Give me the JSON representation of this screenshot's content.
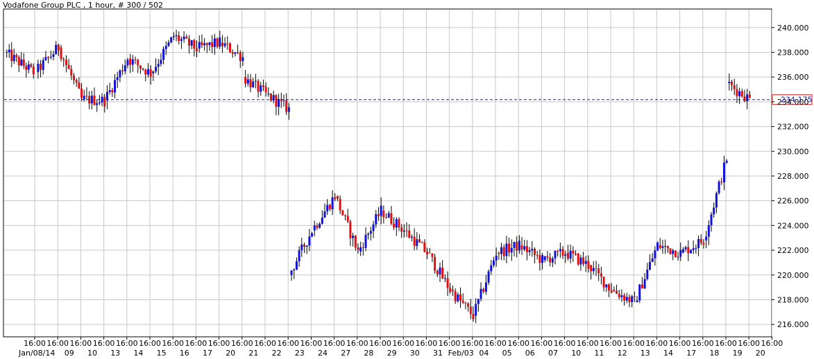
{
  "chart_data": {
    "type": "candlestick",
    "title": "Vodafone Group PLC , 1 hour, # 300 / 502",
    "ylim": [
      215.0,
      241.5
    ],
    "y_ticks": [
      "216.000",
      "218.000",
      "220.000",
      "222.000",
      "224.000",
      "226.000",
      "228.000",
      "230.000",
      "232.000",
      "234.000",
      "236.000",
      "238.000",
      "240.000"
    ],
    "y_tick_values": [
      216,
      218,
      220,
      222,
      224,
      226,
      228,
      230,
      232,
      234,
      236,
      238,
      240
    ],
    "current_price": 234.175,
    "current_price_label": "234.175",
    "grid": true,
    "time_labels": [
      "16:00",
      "16:00",
      "16:00",
      "16:00",
      "16:00",
      "16:00",
      "16:00",
      "16:00",
      "16:00",
      "16:00",
      "16:00",
      "16:00",
      "16:00",
      "16:00",
      "16:00",
      "16:00",
      "16:00",
      "16:00",
      "16:00",
      "16:00",
      "16:00",
      "16:00",
      "16:00",
      "16:00",
      "16:00",
      "16:00",
      "16:00",
      "16:00",
      "16:00",
      "16:00",
      "16:00",
      "16:00",
      "16:00"
    ],
    "date_labels": [
      "Jan/08/14",
      "09",
      "10",
      "13",
      "14",
      "15",
      "16",
      "17",
      "20",
      "21",
      "22",
      "23",
      "24",
      "27",
      "28",
      "29",
      "30",
      "31",
      "Feb/03",
      "04",
      "05",
      "06",
      "07",
      "10",
      "11",
      "12",
      "13",
      "14",
      "17",
      "18",
      "19",
      "20"
    ],
    "colors": {
      "up": "#1010d8",
      "down": "#e01010",
      "grid": "#c8c8c8",
      "price_line": "#1a1aa8"
    },
    "bar_width_note": "",
    "days": [
      {
        "label": "Jan/08/14",
        "start": 238.0,
        "end": 236.4
      },
      {
        "label": "09",
        "start": 236.4,
        "end": 238.4
      },
      {
        "label": "10",
        "start": 238.4,
        "end": 234.2
      },
      {
        "label": "13",
        "start": 234.2,
        "end": 234.1
      },
      {
        "label": "14",
        "start": 234.1,
        "end": 237.5
      },
      {
        "label": "15",
        "start": 237.5,
        "end": 236.3
      },
      {
        "label": "16",
        "start": 236.3,
        "end": 239.3
      },
      {
        "label": "17",
        "start": 239.3,
        "end": 238.3
      },
      {
        "label": "20",
        "start": 238.3,
        "end": 238.8
      },
      {
        "label": "21",
        "start": 238.8,
        "end": 237.6
      },
      {
        "label": "22",
        "start": 236.0,
        "end": 234.6
      },
      {
        "label": "23",
        "start": 234.6,
        "end": 233.4
      },
      {
        "label": "24",
        "start": 220.0,
        "end": 223.6
      },
      {
        "label": "27",
        "start": 223.6,
        "end": 226.4
      },
      {
        "label": "28",
        "start": 226.4,
        "end": 221.9
      },
      {
        "label": "29",
        "start": 221.9,
        "end": 225.2
      },
      {
        "label": "30",
        "start": 225.2,
        "end": 223.6
      },
      {
        "label": "31",
        "start": 223.6,
        "end": 221.8
      },
      {
        "label": "Feb/03",
        "start": 221.8,
        "end": 218.8
      },
      {
        "label": "04",
        "start": 218.8,
        "end": 216.7
      },
      {
        "label": "05",
        "start": 216.7,
        "end": 221.8
      },
      {
        "label": "06",
        "start": 221.8,
        "end": 222.4
      },
      {
        "label": "07",
        "start": 222.4,
        "end": 221.2
      },
      {
        "label": "10",
        "start": 221.2,
        "end": 221.8
      },
      {
        "label": "11",
        "start": 221.8,
        "end": 220.8
      },
      {
        "label": "12",
        "start": 220.8,
        "end": 218.8
      },
      {
        "label": "13",
        "start": 218.8,
        "end": 217.8
      },
      {
        "label": "14",
        "start": 217.8,
        "end": 222.4
      },
      {
        "label": "17",
        "start": 222.4,
        "end": 221.8
      },
      {
        "label": "18",
        "start": 221.8,
        "end": 222.8
      },
      {
        "label": "19",
        "start": 222.8,
        "end": 229.4
      },
      {
        "label": "20",
        "start": 235.5,
        "end": 234.2
      }
    ]
  }
}
